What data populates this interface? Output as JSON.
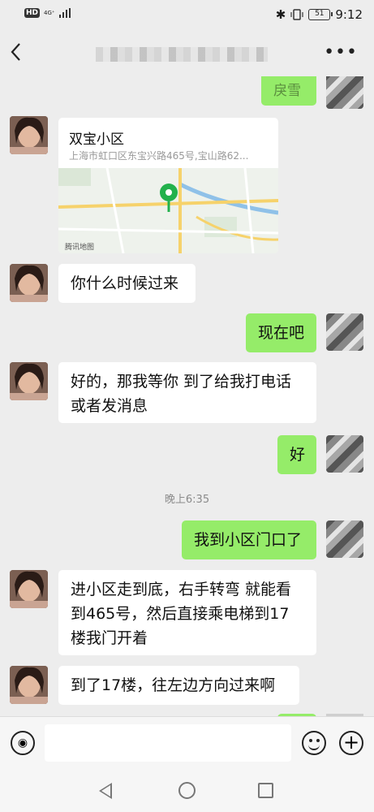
{
  "status_bar": {
    "hd": "HD",
    "network": "4G⁺",
    "time": "9:12",
    "battery": "51",
    "icons": [
      "bluetooth-icon",
      "vibrate-icon",
      "battery-icon"
    ]
  },
  "nav_bar": {
    "back_icon": "chevron-left-icon",
    "title_obscured": true,
    "more_icon": "more-icon"
  },
  "messages": [
    {
      "side": "out",
      "text": "戾雪"
    },
    {
      "side": "in",
      "type": "location",
      "title": "双宝小区",
      "address": "上海市虹口区东宝兴路465号,宝山路62...",
      "map_source": "腾讯地图"
    },
    {
      "side": "in",
      "text": "你什么时候过来"
    },
    {
      "side": "out",
      "text": "现在吧"
    },
    {
      "side": "in",
      "text": "好的，那我等你 到了给我打电话或者发消息"
    },
    {
      "side": "out",
      "text": "好"
    },
    {
      "type": "time",
      "text": "晚上6:35"
    },
    {
      "side": "out",
      "text": "我到小区门口了"
    },
    {
      "side": "in",
      "text": "进小区走到底，右手转弯 就能看到465号，然后直接乘电梯到17楼我门开着"
    },
    {
      "side": "in",
      "text": "到了17楼，往左边方向过来啊"
    }
  ],
  "input_bar": {
    "voice_icon": "voice-icon",
    "emoji_icon": "emoji-icon",
    "plus_icon": "plus-icon",
    "text_value": ""
  },
  "system_nav": {
    "back": "nav-back-icon",
    "home": "nav-home-icon",
    "recent": "nav-recent-icon"
  },
  "colors": {
    "background": "#ededed",
    "outgoing_bubble": "#95ec69",
    "incoming_bubble": "#ffffff",
    "timestamp": "#8b8b8b"
  }
}
